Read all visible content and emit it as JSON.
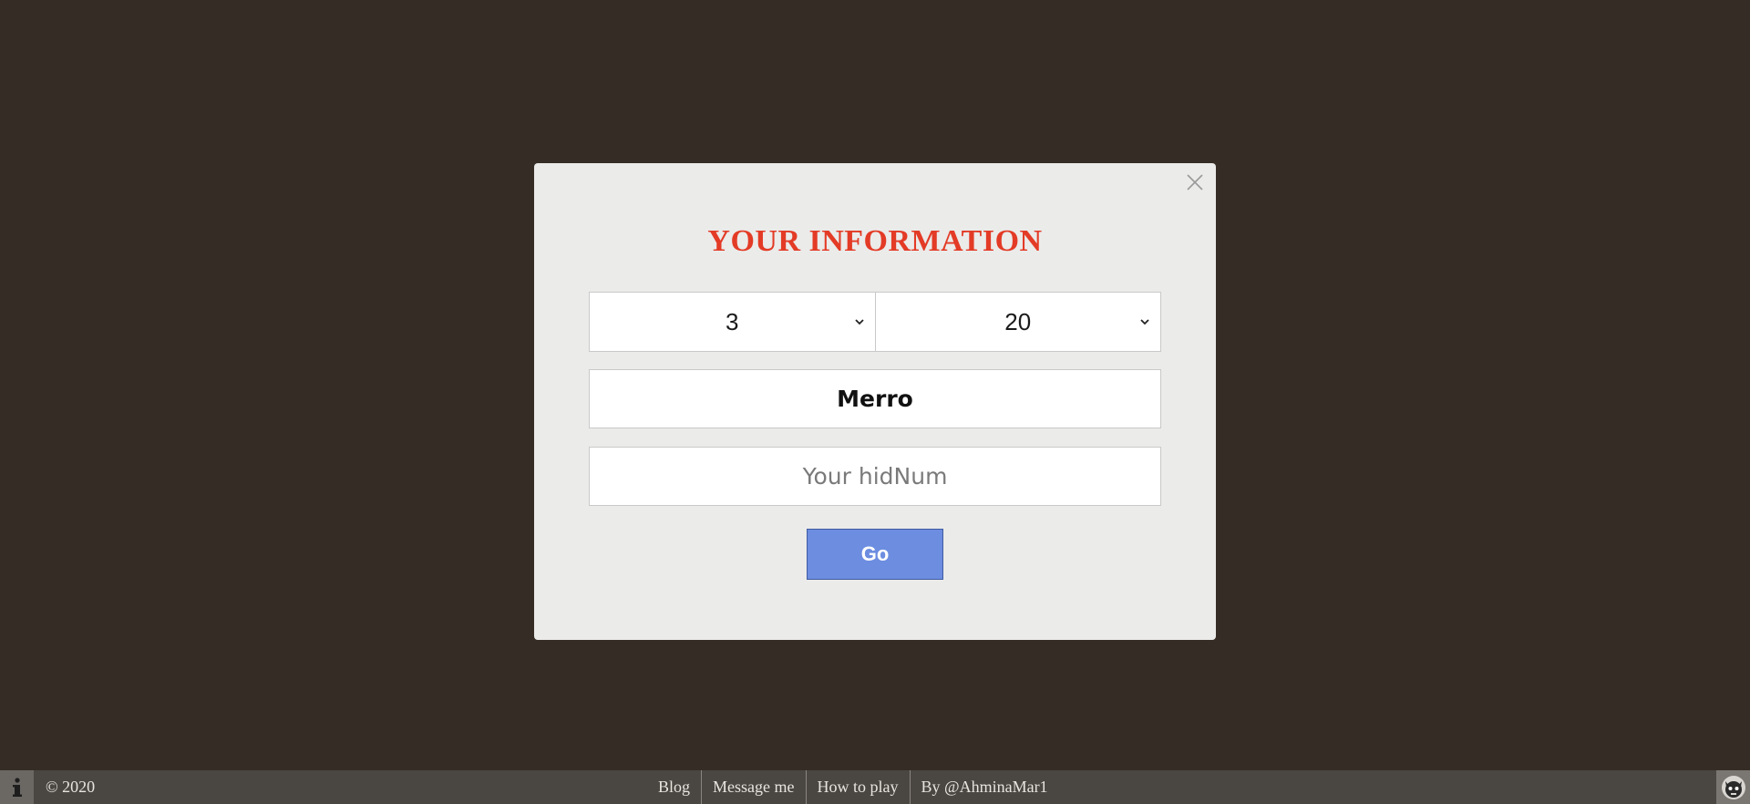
{
  "modal": {
    "title": "YOUR INFORMATION",
    "select_a": {
      "value": "3"
    },
    "select_b": {
      "value": "20"
    },
    "name_field": {
      "value": "Merro"
    },
    "hidnum_field": {
      "placeholder": "Your hidNum"
    },
    "go_label": "Go",
    "colors": {
      "title": "#e33b26",
      "go_button": "#6c8de0",
      "background": "#ebebea"
    }
  },
  "footer": {
    "copyright": "© 2020",
    "links": [
      "Blog",
      "Message me",
      "How to play",
      "By @AhminaMar1"
    ],
    "info_icon": "info-icon",
    "avatar_icon": "avatar-icon"
  },
  "page": {
    "background": "#352d25"
  }
}
